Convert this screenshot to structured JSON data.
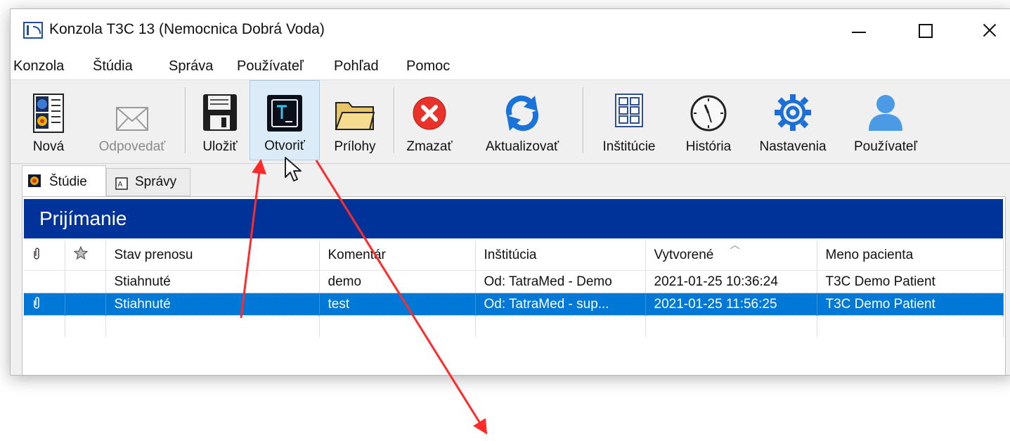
{
  "window": {
    "title": "Konzola T3C 13 (Nemocnica Dobrá Voda)"
  },
  "menu": [
    "Konzola",
    "Štúdia",
    "Správa",
    "Používateľ",
    "Pohľad",
    "Pomoc"
  ],
  "toolbar": {
    "nova": "Nová",
    "odpovedat": "Odpovedať",
    "ulozit": "Uložiť",
    "otvorit": "Otvoriť",
    "prilohy": "Prílohy",
    "zmazat": "Zmazať",
    "aktualizovat": "Aktualizovať",
    "institucie": "Inštitúcie",
    "historia": "História",
    "nastavenia": "Nastavenia",
    "pouzivatel": "Používateľ"
  },
  "tabs": {
    "studie": "Štúdie",
    "spravy": "Správy"
  },
  "panel": {
    "title": "Prijímanie"
  },
  "table": {
    "columns": [
      "Stav prenosu",
      "Komentár",
      "Inštitúcia",
      "Vytvorené",
      "Meno pacienta"
    ],
    "rows": [
      {
        "stav": "Stiahnuté",
        "komentar": "demo",
        "institucia": "Od: TatraMed - Demo",
        "vytvorene": "2021-01-25 10:36:24",
        "pacient": "T3C Demo Patient"
      },
      {
        "stav": "Stiahnuté",
        "komentar": "test",
        "institucia": "Od: TatraMed - sup...",
        "vytvorene": "2021-01-25 11:56:25",
        "pacient": "T3C Demo Patient",
        "selected": true
      }
    ]
  },
  "colors": {
    "panel_header": "#003399",
    "selection": "#0078d7",
    "annotation_arrow": "#ff2a2a"
  }
}
